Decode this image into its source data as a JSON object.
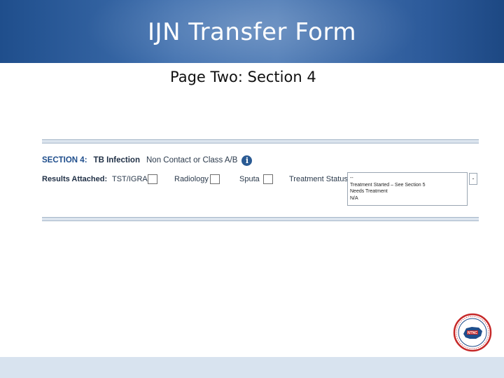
{
  "header": {
    "title": "IJN Transfer Form"
  },
  "page": {
    "subtitle": "Page Two: Section 4"
  },
  "section": {
    "number_label": "SECTION 4:",
    "name": "TB Infection",
    "description": "Non Contact or Class A/B",
    "info_icon": "info-icon"
  },
  "results": {
    "label": "Results Attached:",
    "items": [
      {
        "label": "TST/IGRA",
        "checked": false
      },
      {
        "label": "Radiology",
        "checked": false
      },
      {
        "label": "Sputa",
        "checked": false
      }
    ],
    "treatment_status_label": "Treatment Status",
    "treatment_status_options": [
      "--",
      "Treatment Started – See Section 5",
      "Needs Treatment",
      "N/A"
    ]
  },
  "logo": {
    "seal_text": "NTNC"
  },
  "colors": {
    "header_blue": "#2c5a9a",
    "section_blue": "#1f4e8c",
    "info_icon_blue": "#2a5a93",
    "footer_bar": "#d8e3ef"
  }
}
